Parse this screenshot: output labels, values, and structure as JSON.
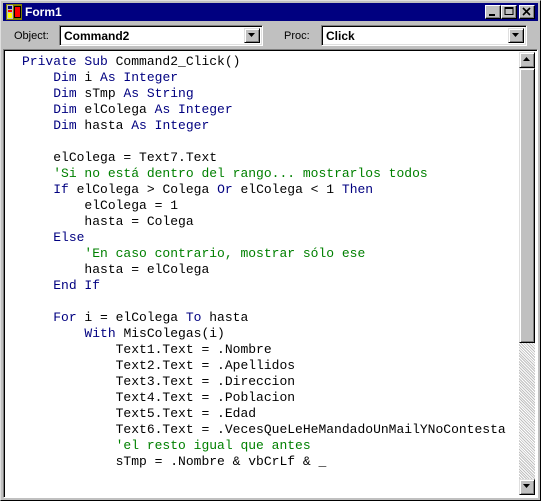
{
  "window": {
    "title": "Form1"
  },
  "toolbar": {
    "object_label": "Object:",
    "object_value": "Command2",
    "proc_label": "Proc:",
    "proc_value": "Click"
  },
  "code": {
    "indent_unit": "    ",
    "lines": [
      {
        "indent": 0,
        "tokens": [
          {
            "t": "kw",
            "v": "Private Sub"
          },
          {
            "t": "tx",
            "v": " Command2_Click()"
          }
        ]
      },
      {
        "indent": 1,
        "tokens": [
          {
            "t": "kw",
            "v": "Dim"
          },
          {
            "t": "tx",
            "v": " i "
          },
          {
            "t": "kw",
            "v": "As Integer"
          }
        ]
      },
      {
        "indent": 1,
        "tokens": [
          {
            "t": "kw",
            "v": "Dim"
          },
          {
            "t": "tx",
            "v": " sTmp "
          },
          {
            "t": "kw",
            "v": "As String"
          }
        ]
      },
      {
        "indent": 1,
        "tokens": [
          {
            "t": "kw",
            "v": "Dim"
          },
          {
            "t": "tx",
            "v": " elColega "
          },
          {
            "t": "kw",
            "v": "As Integer"
          }
        ]
      },
      {
        "indent": 1,
        "tokens": [
          {
            "t": "kw",
            "v": "Dim"
          },
          {
            "t": "tx",
            "v": " hasta "
          },
          {
            "t": "kw",
            "v": "As Integer"
          }
        ]
      },
      {
        "indent": 0,
        "tokens": []
      },
      {
        "indent": 1,
        "tokens": [
          {
            "t": "tx",
            "v": "elColega = Text7.Text"
          }
        ]
      },
      {
        "indent": 1,
        "tokens": [
          {
            "t": "cm",
            "v": "'Si no está dentro del rango... mostrarlos todos"
          }
        ]
      },
      {
        "indent": 1,
        "tokens": [
          {
            "t": "kw",
            "v": "If"
          },
          {
            "t": "tx",
            "v": " elColega > Colega "
          },
          {
            "t": "kw",
            "v": "Or"
          },
          {
            "t": "tx",
            "v": " elColega < 1 "
          },
          {
            "t": "kw",
            "v": "Then"
          }
        ]
      },
      {
        "indent": 2,
        "tokens": [
          {
            "t": "tx",
            "v": "elColega = 1"
          }
        ]
      },
      {
        "indent": 2,
        "tokens": [
          {
            "t": "tx",
            "v": "hasta = Colega"
          }
        ]
      },
      {
        "indent": 1,
        "tokens": [
          {
            "t": "kw",
            "v": "Else"
          }
        ]
      },
      {
        "indent": 2,
        "tokens": [
          {
            "t": "cm",
            "v": "'En caso contrario, mostrar sólo ese"
          }
        ]
      },
      {
        "indent": 2,
        "tokens": [
          {
            "t": "tx",
            "v": "hasta = elColega"
          }
        ]
      },
      {
        "indent": 1,
        "tokens": [
          {
            "t": "kw",
            "v": "End If"
          }
        ]
      },
      {
        "indent": 0,
        "tokens": []
      },
      {
        "indent": 1,
        "tokens": [
          {
            "t": "kw",
            "v": "For"
          },
          {
            "t": "tx",
            "v": " i = elColega "
          },
          {
            "t": "kw",
            "v": "To"
          },
          {
            "t": "tx",
            "v": " hasta"
          }
        ]
      },
      {
        "indent": 2,
        "tokens": [
          {
            "t": "kw",
            "v": "With"
          },
          {
            "t": "tx",
            "v": " MisColegas(i)"
          }
        ]
      },
      {
        "indent": 3,
        "tokens": [
          {
            "t": "tx",
            "v": "Text1.Text = .Nombre"
          }
        ]
      },
      {
        "indent": 3,
        "tokens": [
          {
            "t": "tx",
            "v": "Text2.Text = .Apellidos"
          }
        ]
      },
      {
        "indent": 3,
        "tokens": [
          {
            "t": "tx",
            "v": "Text3.Text = .Direccion"
          }
        ]
      },
      {
        "indent": 3,
        "tokens": [
          {
            "t": "tx",
            "v": "Text4.Text = .Poblacion"
          }
        ]
      },
      {
        "indent": 3,
        "tokens": [
          {
            "t": "tx",
            "v": "Text5.Text = .Edad"
          }
        ]
      },
      {
        "indent": 3,
        "tokens": [
          {
            "t": "tx",
            "v": "Text6.Text = .VecesQueLeHeMandadoUnMailYNoContesta"
          }
        ]
      },
      {
        "indent": 3,
        "tokens": [
          {
            "t": "cm",
            "v": "'el resto igual que antes"
          }
        ]
      },
      {
        "indent": 3,
        "tokens": [
          {
            "t": "tx",
            "v": "sTmp = .Nombre & vbCrLf & _"
          }
        ]
      }
    ]
  },
  "scrollbar": {
    "thumb_position": 0.0
  },
  "colors": {
    "title_bar": "#000080",
    "keyword": "#000080",
    "comment": "#008000",
    "text": "#000000"
  }
}
